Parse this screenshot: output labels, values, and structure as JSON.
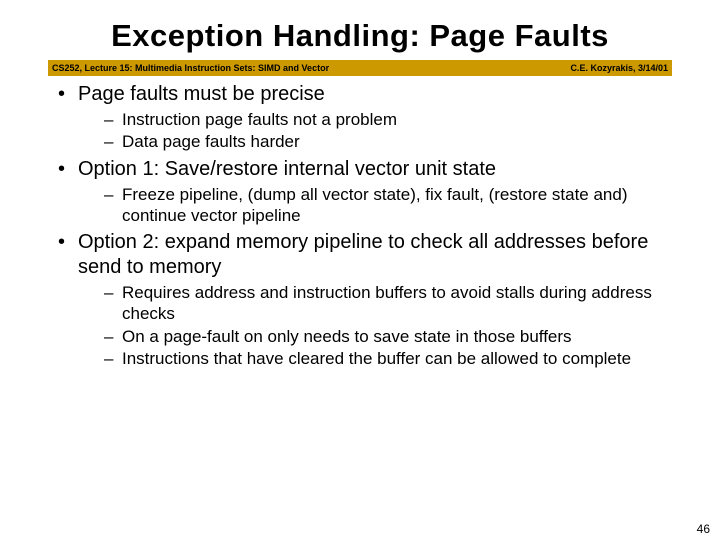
{
  "title": "Exception Handling: Page Faults",
  "bar": {
    "left": "CS252, Lecture 15: Multimedia Instruction Sets: SIMD and Vector",
    "right": "C.E. Kozyrakis, 3/14/01"
  },
  "bullets": [
    {
      "text": "Page faults must be precise",
      "sub": [
        "Instruction page faults not a problem",
        "Data page faults harder"
      ]
    },
    {
      "text": "Option 1: Save/restore internal vector unit state",
      "sub": [
        "Freeze pipeline, (dump all vector state), fix fault, (restore state and) continue vector pipeline"
      ]
    },
    {
      "text": "Option 2: expand memory pipeline to check all addresses before send to memory",
      "sub": [
        "Requires address and instruction buffers to avoid stalls during address checks",
        "On a page-fault on only needs to save state in those buffers",
        "Instructions that have cleared the buffer can be allowed to complete"
      ]
    }
  ],
  "pagenum": "46"
}
